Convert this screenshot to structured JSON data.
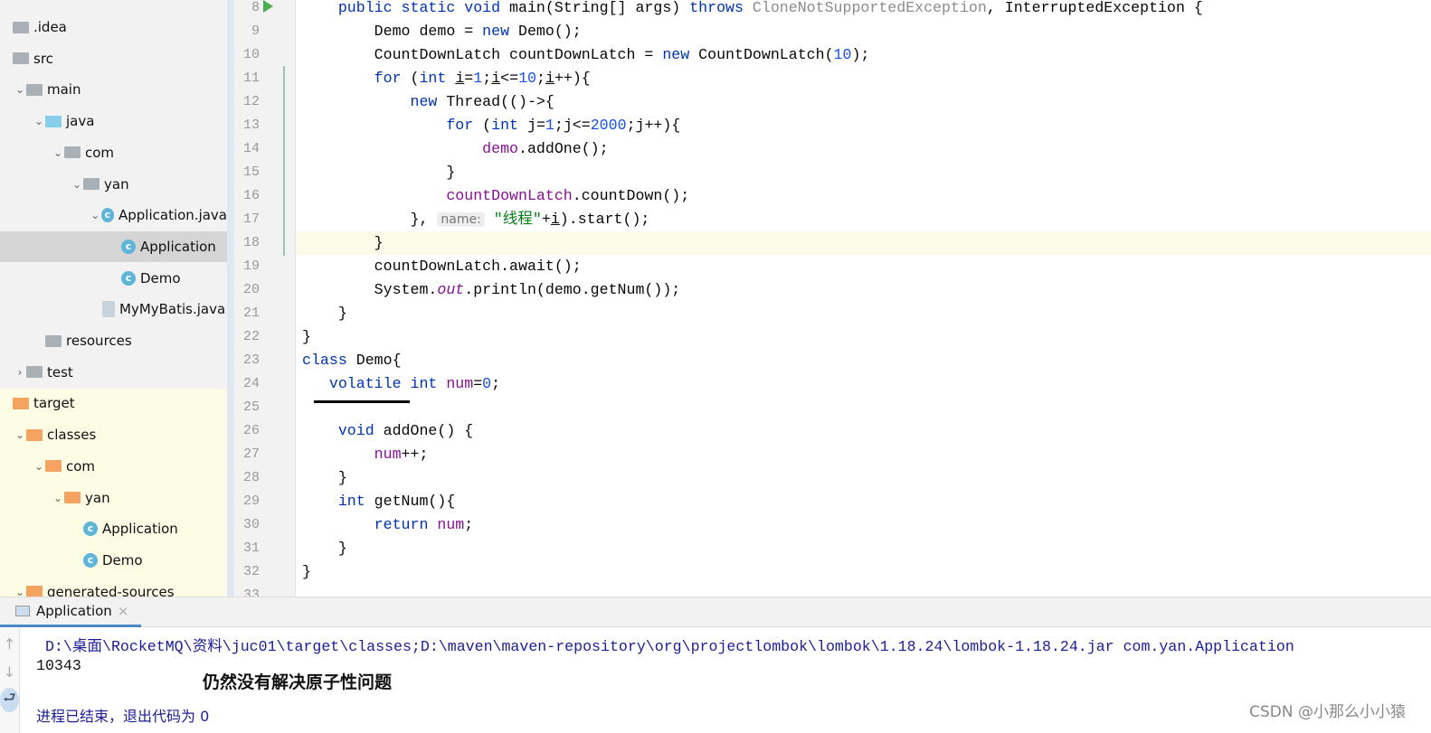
{
  "tree": [
    {
      "label": ".idea",
      "depth": 0,
      "chev": "",
      "icon": "folder-gray"
    },
    {
      "label": "src",
      "depth": 0,
      "chev": "",
      "icon": "folder-gray"
    },
    {
      "label": "main",
      "depth": 1,
      "chev": "v",
      "icon": "folder-gray"
    },
    {
      "label": "java",
      "depth": 2,
      "chev": "v",
      "icon": "folder-blue"
    },
    {
      "label": "com",
      "depth": 3,
      "chev": "v",
      "icon": "package"
    },
    {
      "label": "yan",
      "depth": 4,
      "chev": "v",
      "icon": "package"
    },
    {
      "label": "Application.java",
      "depth": 5,
      "chev": "v",
      "icon": "class-run"
    },
    {
      "label": "Application",
      "depth": 6,
      "chev": "",
      "icon": "class-run",
      "selected": true
    },
    {
      "label": "Demo",
      "depth": 6,
      "chev": "",
      "icon": "class"
    },
    {
      "label": "MyMyBatis.java",
      "depth": 5,
      "chev": "",
      "icon": "java-file"
    },
    {
      "label": "resources",
      "depth": 2,
      "chev": "",
      "icon": "resources-folder"
    },
    {
      "label": "test",
      "depth": 1,
      "chev": ">",
      "icon": "folder-gray"
    },
    {
      "label": "target",
      "depth": 0,
      "chev": "",
      "icon": "folder-orange"
    },
    {
      "label": "classes",
      "depth": 1,
      "chev": "v",
      "icon": "folder-orange"
    },
    {
      "label": "com",
      "depth": 2,
      "chev": "v",
      "icon": "folder-orange"
    },
    {
      "label": "yan",
      "depth": 3,
      "chev": "v",
      "icon": "folder-orange"
    },
    {
      "label": "Application",
      "depth": 4,
      "chev": "",
      "icon": "class-run"
    },
    {
      "label": "Demo",
      "depth": 4,
      "chev": "",
      "icon": "class"
    },
    {
      "label": "generated-sources",
      "depth": 1,
      "chev": "v",
      "icon": "folder-orange"
    }
  ],
  "code": [
    {
      "n": "8",
      "t": [
        [
          "k",
          "    public static void "
        ],
        [
          "",
          "main(String"
        ],
        [
          "",
          "[] args) "
        ],
        [
          "k",
          "throws "
        ],
        [
          "g",
          "CloneNotSupportedException"
        ],
        [
          "",
          ", InterruptedException {"
        ]
      ]
    },
    {
      "n": "9",
      "t": [
        [
          "",
          "        Demo demo = "
        ],
        [
          "k",
          "new "
        ],
        [
          "",
          "Demo();"
        ]
      ]
    },
    {
      "n": "10",
      "t": [
        [
          "",
          "        CountDownLatch countDownLatch = "
        ],
        [
          "k",
          "new "
        ],
        [
          "",
          "CountDownLatch("
        ],
        [
          "n",
          "10"
        ],
        [
          "",
          ");"
        ]
      ]
    },
    {
      "n": "11",
      "t": [
        [
          "k",
          "        for "
        ],
        [
          "",
          "("
        ],
        [
          "k",
          "int "
        ],
        [
          "u",
          "i"
        ],
        [
          "",
          "="
        ],
        [
          "n",
          "1"
        ],
        [
          "",
          ";"
        ],
        [
          "u",
          "i"
        ],
        [
          "",
          "<="
        ],
        [
          "n",
          "10"
        ],
        [
          "",
          ";"
        ],
        [
          "u",
          "i"
        ],
        [
          "",
          "++){"
        ]
      ]
    },
    {
      "n": "12",
      "t": [
        [
          "k",
          "            new "
        ],
        [
          "",
          "Thread(()->{"
        ]
      ]
    },
    {
      "n": "13",
      "t": [
        [
          "k",
          "                for "
        ],
        [
          "",
          "("
        ],
        [
          "k",
          "int "
        ],
        [
          "",
          "j="
        ],
        [
          "n",
          "1"
        ],
        [
          "",
          ";j<="
        ],
        [
          "n",
          "2000"
        ],
        [
          "",
          ";j++){"
        ]
      ]
    },
    {
      "n": "14",
      "t": [
        [
          "f",
          "                    demo"
        ],
        [
          "",
          ".addOne();"
        ]
      ]
    },
    {
      "n": "15",
      "t": [
        [
          "",
          "                }"
        ]
      ]
    },
    {
      "n": "16",
      "t": [
        [
          "f",
          "                countDownLatch"
        ],
        [
          "",
          ".countDown();"
        ]
      ]
    },
    {
      "n": "17",
      "t": [
        [
          "",
          "            }, "
        ],
        [
          "hint",
          "name:"
        ],
        [
          "s",
          " \"线程\""
        ],
        [
          "",
          "+"
        ],
        [
          "u",
          "i"
        ],
        [
          "",
          ").start();"
        ]
      ]
    },
    {
      "n": "18",
      "t": [
        [
          "",
          "        }"
        ]
      ]
    },
    {
      "n": "19",
      "t": [
        [
          "",
          "        countDownLatch.await();"
        ]
      ]
    },
    {
      "n": "20",
      "t": [
        [
          "",
          "        System."
        ],
        [
          "i",
          "out"
        ],
        [
          "",
          ".println(demo.getNum());"
        ]
      ]
    },
    {
      "n": "21",
      "t": [
        [
          "",
          "    }"
        ]
      ]
    },
    {
      "n": "22",
      "t": [
        [
          "",
          "}"
        ]
      ]
    },
    {
      "n": "23",
      "t": [
        [
          "k",
          "class "
        ],
        [
          "",
          "Demo{"
        ]
      ]
    },
    {
      "n": "24",
      "t": [
        [
          "k",
          "   volatile int "
        ],
        [
          "f",
          "num"
        ],
        [
          "",
          "="
        ],
        [
          "n",
          "0"
        ],
        [
          "",
          ";"
        ]
      ]
    },
    {
      "n": "25",
      "t": []
    },
    {
      "n": "26",
      "t": [
        [
          "k",
          "    void "
        ],
        [
          "",
          "addOne() {"
        ]
      ]
    },
    {
      "n": "27",
      "t": [
        [
          "f",
          "        num"
        ],
        [
          "",
          "++;"
        ]
      ]
    },
    {
      "n": "28",
      "t": [
        [
          "",
          "    }"
        ]
      ]
    },
    {
      "n": "29",
      "t": [
        [
          "k",
          "    int "
        ],
        [
          "",
          "getNum(){"
        ]
      ]
    },
    {
      "n": "30",
      "t": [
        [
          "k",
          "        return "
        ],
        [
          "f",
          "num"
        ],
        [
          "",
          ";"
        ]
      ]
    },
    {
      "n": "31",
      "t": [
        [
          "",
          "    }"
        ]
      ]
    },
    {
      "n": "32",
      "t": [
        [
          "",
          "}"
        ]
      ]
    },
    {
      "n": "33",
      "t": []
    }
  ],
  "run": {
    "tab_label": "Application",
    "command": " D:\\桌面\\RocketMQ\\资料\\juc01\\target\\classes;D:\\maven\\maven-repository\\org\\projectlombok\\lombok\\1.18.24\\lombok-1.18.24.jar com.yan.Application",
    "output": "10343",
    "annotation": "仍然没有解决原子性问题",
    "exit": "进程已结束，退出代码为 0"
  },
  "watermark": "CSDN @小那么小小猿"
}
